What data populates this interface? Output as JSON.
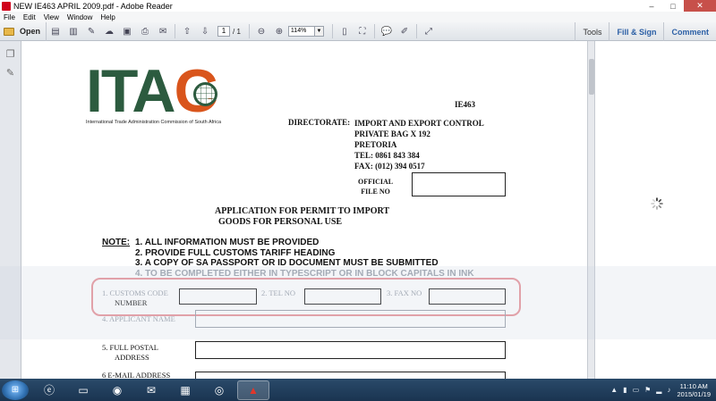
{
  "window": {
    "title": "NEW IE463 APRIL 2009.pdf - Adobe Reader",
    "controls": {
      "minimize": "–",
      "maximize": "□",
      "close": "✕"
    }
  },
  "menu": [
    "File",
    "Edit",
    "View",
    "Window",
    "Help"
  ],
  "toolbar": {
    "open_label": "Open",
    "current_page": "1",
    "page_total": "/ 1",
    "zoom": "114%",
    "tools_label": "Tools",
    "fill_sign_label": "Fill & Sign",
    "comment_label": "Comment"
  },
  "document": {
    "logo_text": "ITA",
    "logo_c": "C",
    "logo_subtitle": "International Trade Administration Commission of South Africa",
    "form_code": "IE463",
    "directorate_label": "DIRECTORATE:",
    "directorate_lines": [
      "IMPORT AND EXPORT CONTROL",
      "PRIVATE BAG X 192",
      "PRETORIA",
      "TEL: 0861 843 384",
      "FAX: (012) 394 0517"
    ],
    "official_label_1": "OFFICIAL",
    "official_label_2": "FILE NO",
    "title_line_1": "APPLICATION FOR PERMIT TO IMPORT",
    "title_line_2": "GOODS FOR PERSONAL USE",
    "note_label": "NOTE:",
    "notes": [
      "1.   ALL INFORMATION MUST BE PROVIDED",
      "2.   PROVIDE FULL CUSTOMS TARIFF HEADING",
      "3.   A COPY OF SA PASSPORT OR ID DOCUMENT MUST BE SUBMITTED",
      "4.   TO BE COMPLETED EITHER IN TYPESCRIPT OR IN BLOCK CAPITALS IN INK"
    ],
    "fields": {
      "customs_code_1": "1.   CUSTOMS CODE",
      "customs_code_2": "NUMBER",
      "tel_no": "2.   TEL NO",
      "fax_no": "3.   FAX NO",
      "applicant_name": "4.   APPLICANT NAME",
      "postal_1": "5.   FULL POSTAL",
      "postal_2": "ADDRESS",
      "email": "6   E-MAIL ADDRESS"
    }
  },
  "taskbar": {
    "time": "11:10 AM",
    "date": "2015/01/19"
  },
  "colors": {
    "logo_green": "#2c5b3f",
    "logo_orange": "#d9551c",
    "highlight": "#e8949a",
    "taskbar": "#1a3450"
  }
}
